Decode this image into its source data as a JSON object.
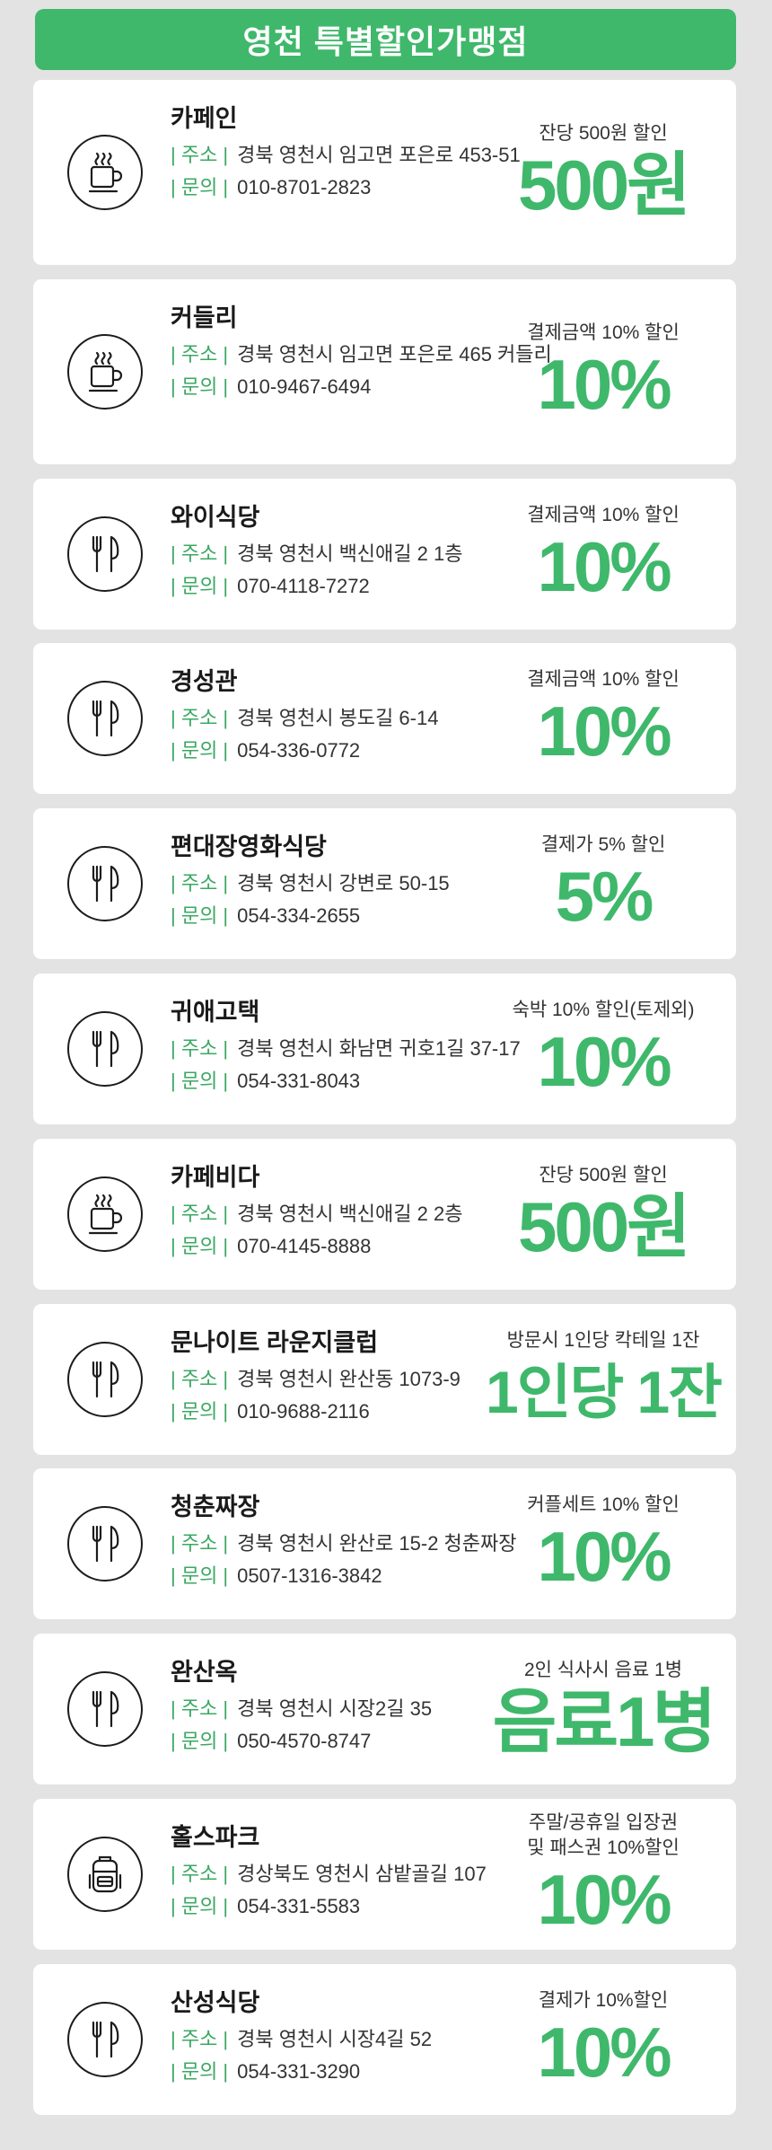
{
  "header": {
    "title": "영천 특별할인가맹점"
  },
  "labels": {
    "address": "| 주소 |",
    "phone": "| 문의 |"
  },
  "stores": [
    {
      "name": "카페인",
      "icon": "coffee-cup-icon",
      "address": "경북 영천시 임고면 포은로 453-51",
      "phone": "010-8701-2823",
      "desc": "잔당 500원 할인",
      "big": "500원"
    },
    {
      "name": "커들리",
      "icon": "coffee-cup-icon",
      "address": "경북 영천시 임고면 포은로 465 커들리",
      "phone": "010-9467-6494",
      "desc": "결제금액 10% 할인",
      "big": "10%"
    },
    {
      "name": "와이식당",
      "icon": "fork-knife-icon",
      "address": "경북 영천시 백신애길 2 1층",
      "phone": "070-4118-7272",
      "desc": "결제금액 10% 할인",
      "big": "10%"
    },
    {
      "name": "경성관",
      "icon": "fork-knife-icon",
      "address": "경북 영천시 봉도길 6-14",
      "phone": "054-336-0772",
      "desc": "결제금액 10% 할인",
      "big": "10%"
    },
    {
      "name": "편대장영화식당",
      "icon": "fork-knife-icon",
      "address": "경북 영천시 강변로 50-15",
      "phone": "054-334-2655",
      "desc": "결제가 5% 할인",
      "big": "5%"
    },
    {
      "name": "귀애고택",
      "icon": "fork-knife-icon",
      "address": "경북 영천시 화남면 귀호1길 37-17",
      "phone": "054-331-8043",
      "desc": "숙박 10% 할인(토제외)",
      "big": "10%"
    },
    {
      "name": "카페비다",
      "icon": "coffee-cup-icon",
      "address": "경북 영천시 백신애길 2 2층",
      "phone": "070-4145-8888",
      "desc": "잔당 500원 할인",
      "big": "500원"
    },
    {
      "name": "문나이트 라운지클럽",
      "icon": "fork-knife-icon",
      "address": "경북 영천시 완산동 1073-9",
      "phone": "010-9688-2116",
      "desc": "방문시 1인당 칵테일 1잔",
      "big": "1인당 1잔"
    },
    {
      "name": "청춘짜장",
      "icon": "fork-knife-icon",
      "address": "경북 영천시 완산로 15-2 청춘짜장",
      "phone": "0507-1316-3842",
      "desc": "커플세트 10% 할인",
      "big": "10%"
    },
    {
      "name": "완산옥",
      "icon": "fork-knife-icon",
      "address": "경북 영천시 시장2길 35",
      "phone": "050-4570-8747",
      "desc": "2인 식사시 음료 1병",
      "big": "음료1병"
    },
    {
      "name": "홀스파크",
      "icon": "backpack-icon",
      "address": "경상북도 영천시 삼밭골길 107",
      "phone": "054-331-5583",
      "desc": "주말/공휴일 입장권\n및 패스권 10%할인",
      "big": "10%"
    },
    {
      "name": "산성식당",
      "icon": "fork-knife-icon",
      "address": "경북 영천시 시장4길 52",
      "phone": "054-331-3290",
      "desc": "결제가 10%할인",
      "big": "10%"
    }
  ]
}
